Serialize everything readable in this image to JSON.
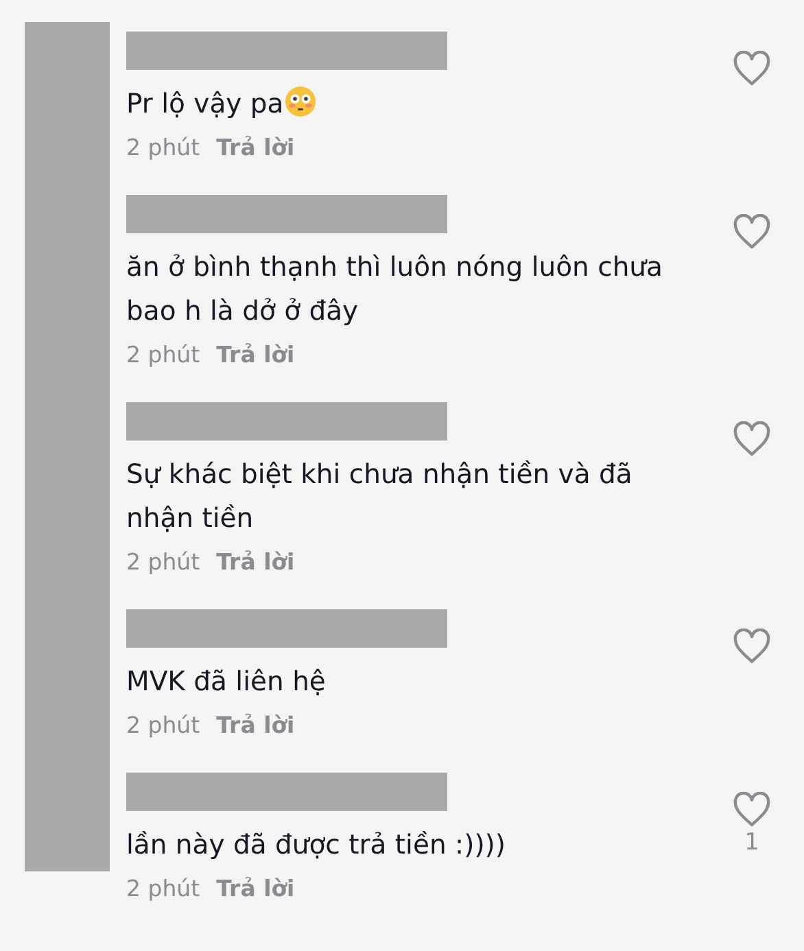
{
  "comments": [
    {
      "text": "Pr lộ vậy pa",
      "emoji": {
        "kind": "flushed"
      },
      "time": "2 phút",
      "reply": "Trả lời",
      "liked": false
    },
    {
      "text": "ăn ở bình thạnh thì luôn nóng luôn chưa bao h là dở ở đây",
      "time": "2 phút",
      "reply": "Trả lời",
      "liked": false
    },
    {
      "text": "Sự khác biệt khi chưa nhận tiền và đã nhận tiền",
      "time": "2 phút",
      "reply": "Trả lời",
      "liked": false
    },
    {
      "text": "MVK đã liên hệ",
      "time": "2 phút",
      "reply": "Trả lời",
      "liked": false
    },
    {
      "text": "lần này đã được trả tiền :))))",
      "time": "2 phút",
      "reply": "Trả lời",
      "liked": false,
      "likes": "1"
    }
  ]
}
